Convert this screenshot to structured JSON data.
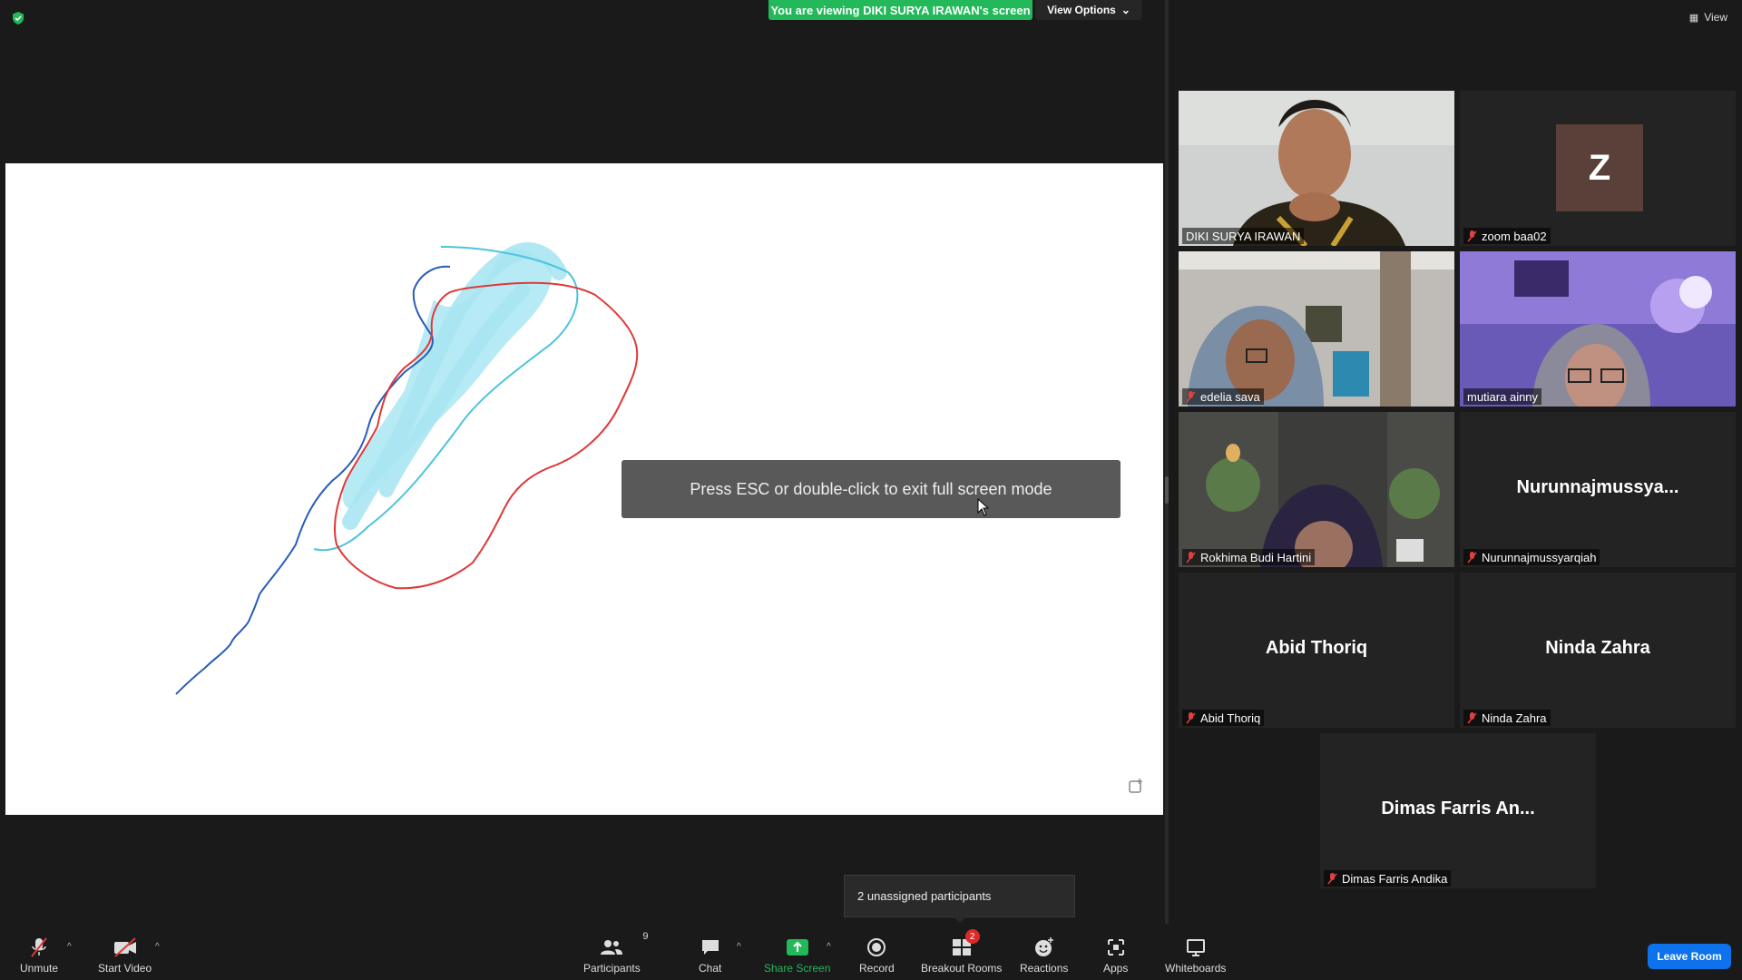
{
  "banner": {
    "viewing_text": "You are viewing DIKI SURYA IRAWAN's screen",
    "view_options_label": "View Options"
  },
  "overlay": {
    "esc_message": "Press ESC or double-click to exit full screen mode"
  },
  "gallery": {
    "view_label": "View",
    "participants": [
      {
        "name": "DIKI SURYA IRAWAN",
        "muted": false,
        "video": true
      },
      {
        "name": "zoom baa02",
        "avatar_letter": "Z",
        "muted": true,
        "video": false
      },
      {
        "name": "edelia sava",
        "muted": true,
        "video": true
      },
      {
        "name": "mutiara ainny",
        "muted": false,
        "video": true,
        "active_speaker": true
      },
      {
        "name": "Rokhima Budi Hartini",
        "muted": true,
        "video": true
      },
      {
        "name": "Nurunnajmussyarqiah",
        "display_name": "Nurunnajmussya...",
        "muted": true,
        "video": false
      },
      {
        "name": "Abid Thoriq",
        "display_name": "Abid Thoriq",
        "muted": true,
        "video": false
      },
      {
        "name": "Ninda Zahra",
        "display_name": "Ninda Zahra",
        "muted": true,
        "video": false
      },
      {
        "name": "Dimas Farris Andika",
        "display_name": "Dimas Farris An...",
        "muted": true,
        "video": false
      }
    ]
  },
  "tooltip": {
    "text": "2 unassigned participants"
  },
  "toolbar": {
    "unmute": "Unmute",
    "start_video": "Start Video",
    "participants": "Participants",
    "participants_count": "9",
    "chat": "Chat",
    "share_screen": "Share Screen",
    "record": "Record",
    "breakout_rooms": "Breakout Rooms",
    "breakout_badge": "2",
    "reactions": "Reactions",
    "apps": "Apps",
    "whiteboards": "Whiteboards",
    "leave": "Leave Room"
  },
  "colors": {
    "share_green": "#23b85a",
    "leave_blue": "#0e72ed",
    "active_outline": "#d8ec58",
    "stroke_blue": "#2a5db8",
    "stroke_cyan": "#4cc4dc",
    "stroke_red": "#e03838",
    "fill_cyan": "#a9e6f2"
  }
}
